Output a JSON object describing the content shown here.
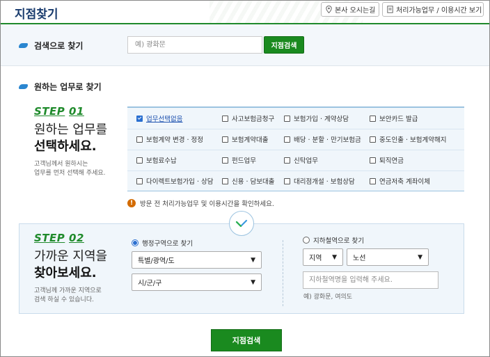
{
  "header": {
    "title": "지점찾기",
    "btn_hq": "본사 오시는길",
    "btn_hours": "처리가능업무 / 이용시간 보기"
  },
  "search": {
    "label": "검색으로 찾기",
    "placeholder": "예) 광화문",
    "button": "지점검색"
  },
  "task": {
    "label": "원하는 업무로 찾기",
    "step_prefix": "STEP",
    "step_num": "01",
    "heading_line1": "원하는 업무를",
    "heading_line2": "선택하세요.",
    "desc_line1": "고객님께서 원하시는",
    "desc_line2": "업무를 먼저 선택해 주세요.",
    "options": [
      {
        "label": "업무선택없음",
        "checked": true
      },
      {
        "label": "사고보험금청구",
        "checked": false
      },
      {
        "label": "보험가입 · 계약상담",
        "checked": false
      },
      {
        "label": "보안카드 발급",
        "checked": false
      },
      {
        "label": "보험계약 변경 · 정정",
        "checked": false
      },
      {
        "label": "보험계약대출",
        "checked": false
      },
      {
        "label": "배당 · 분할 · 만기보험금",
        "checked": false
      },
      {
        "label": "중도인출 · 보험계약해지",
        "checked": false
      },
      {
        "label": "보험료수납",
        "checked": false
      },
      {
        "label": "펀드업무",
        "checked": false
      },
      {
        "label": "신탁업무",
        "checked": false
      },
      {
        "label": "퇴직연금",
        "checked": false
      },
      {
        "label": "다이렉트보험가입 · 상담",
        "checked": false
      },
      {
        "label": "신용 · 담보대출",
        "checked": false
      },
      {
        "label": "대리점개설 · 보험상담",
        "checked": false
      },
      {
        "label": "연금저축 계좌이체",
        "checked": false
      }
    ],
    "notice": "방문 전 처리가능업무 및 이용시간을 확인하세요."
  },
  "region": {
    "step_prefix": "STEP",
    "step_num": "02",
    "heading_line1": "가까운 지역을",
    "heading_line2": "찾아보세요.",
    "desc_line1": "고객님께 가까운 지역으로",
    "desc_line2": "검색 하실 수 있습니다.",
    "admin_radio": "행정구역으로 찾기",
    "admin_selected": true,
    "select_province": "특별/광역/도",
    "select_city": "시/군/구",
    "subway_radio": "지하철역으로 찾기",
    "subway_selected": false,
    "select_region": "지역",
    "select_line": "노선",
    "subway_placeholder": "지하철역명을 입력해 주세요.",
    "example": "예) 광화문, 여의도"
  },
  "main_button": "지점검색",
  "colors": {
    "brand_green": "#1a8a1f",
    "accent_blue": "#2a6fd0",
    "title_navy": "#1a3c6e"
  }
}
